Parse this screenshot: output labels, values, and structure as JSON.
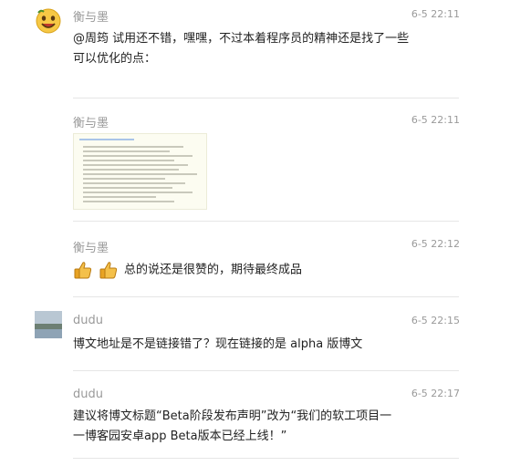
{
  "messages": [
    {
      "name": "衡与墨",
      "time": "6-5 22:11",
      "text_line1": "@周筠 试用还不错，嘿嘿，不过本着程序员的精神还是找了一些",
      "text_line2": "可以优化的点："
    },
    {
      "name": "衡与墨",
      "time": "6-5 22:11"
    },
    {
      "name": "衡与墨",
      "time": "6-5 22:12",
      "text": "总的说还是很赞的，期待最终成品",
      "emoji_icons": [
        "thumbs-up-icon",
        "thumbs-up-icon"
      ]
    },
    {
      "name": "dudu",
      "time": "6-5 22:15",
      "text": "博文地址是不是链接错了？现在链接的是 alpha 版博文"
    },
    {
      "name": "dudu",
      "time": "6-5 22:17",
      "text_line1": "建议将博文标题“Beta阶段发布声明”改为“我们的软工项目一",
      "text_line2": "一博客园安卓app Beta版本已经上线！”"
    }
  ],
  "colors": {
    "meta_text": "#9a9a9a",
    "body_text": "#222222",
    "divider": "#e6e6e6",
    "thumb_bg": "#fcfcf1"
  }
}
